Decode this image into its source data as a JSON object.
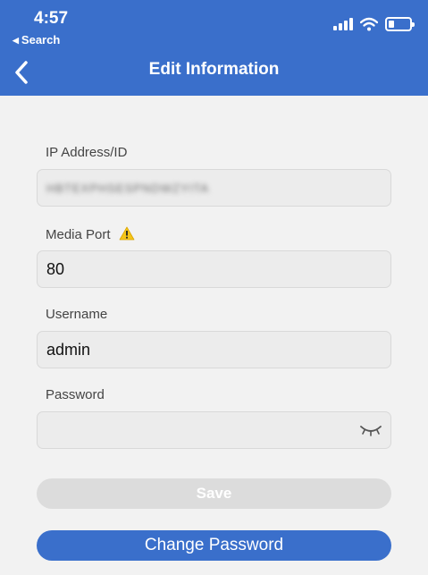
{
  "status_bar": {
    "time": "4:57",
    "back_app": "Search",
    "icons": [
      "cellular-signal-icon",
      "wifi-icon",
      "battery-icon"
    ]
  },
  "header": {
    "title": "Edit Information",
    "back_icon": "chevron-left-icon",
    "color": "#3a6fcb"
  },
  "form": {
    "ip_address": {
      "label": "IP Address/ID",
      "value": "HBTEXPHSESPNDWZYITA"
    },
    "media_port": {
      "label": "Media Port",
      "value": "80",
      "icon": "warning-icon"
    },
    "username": {
      "label": "Username",
      "value": "admin"
    },
    "password": {
      "label": "Password",
      "value": "",
      "icon": "eye-closed-icon"
    }
  },
  "buttons": {
    "save": "Save",
    "change_password": "Change Password"
  }
}
